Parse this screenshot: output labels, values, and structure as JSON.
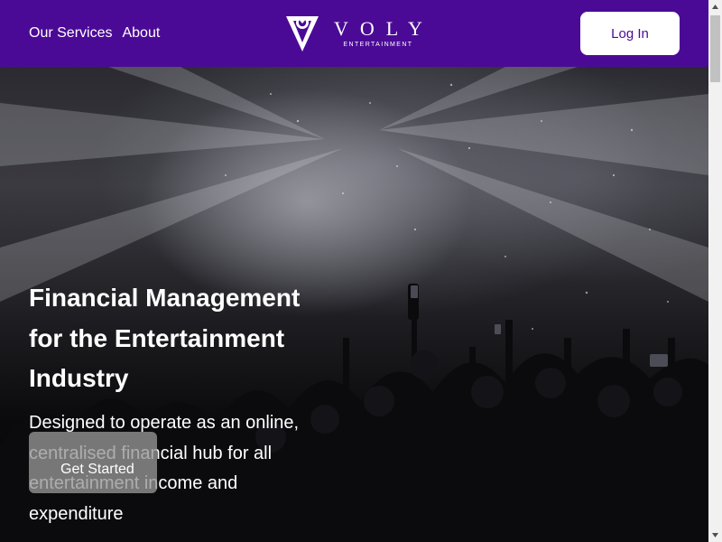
{
  "header": {
    "nav": [
      {
        "label": "Our Services"
      },
      {
        "label": "About"
      }
    ],
    "logo": {
      "name": "VOLY",
      "sub": "ENTERTAINMENT"
    },
    "login_label": "Log In"
  },
  "hero": {
    "headline": "Financial Management for the Entertainment Industry",
    "subline": "Designed to operate as an online, centralised financial hub for all entertainment income and expenditure",
    "cta_label": "Get Started"
  },
  "colors": {
    "brand": "#4b0a96",
    "button_bg": "#ffffff",
    "cta_bg": "#969696"
  }
}
